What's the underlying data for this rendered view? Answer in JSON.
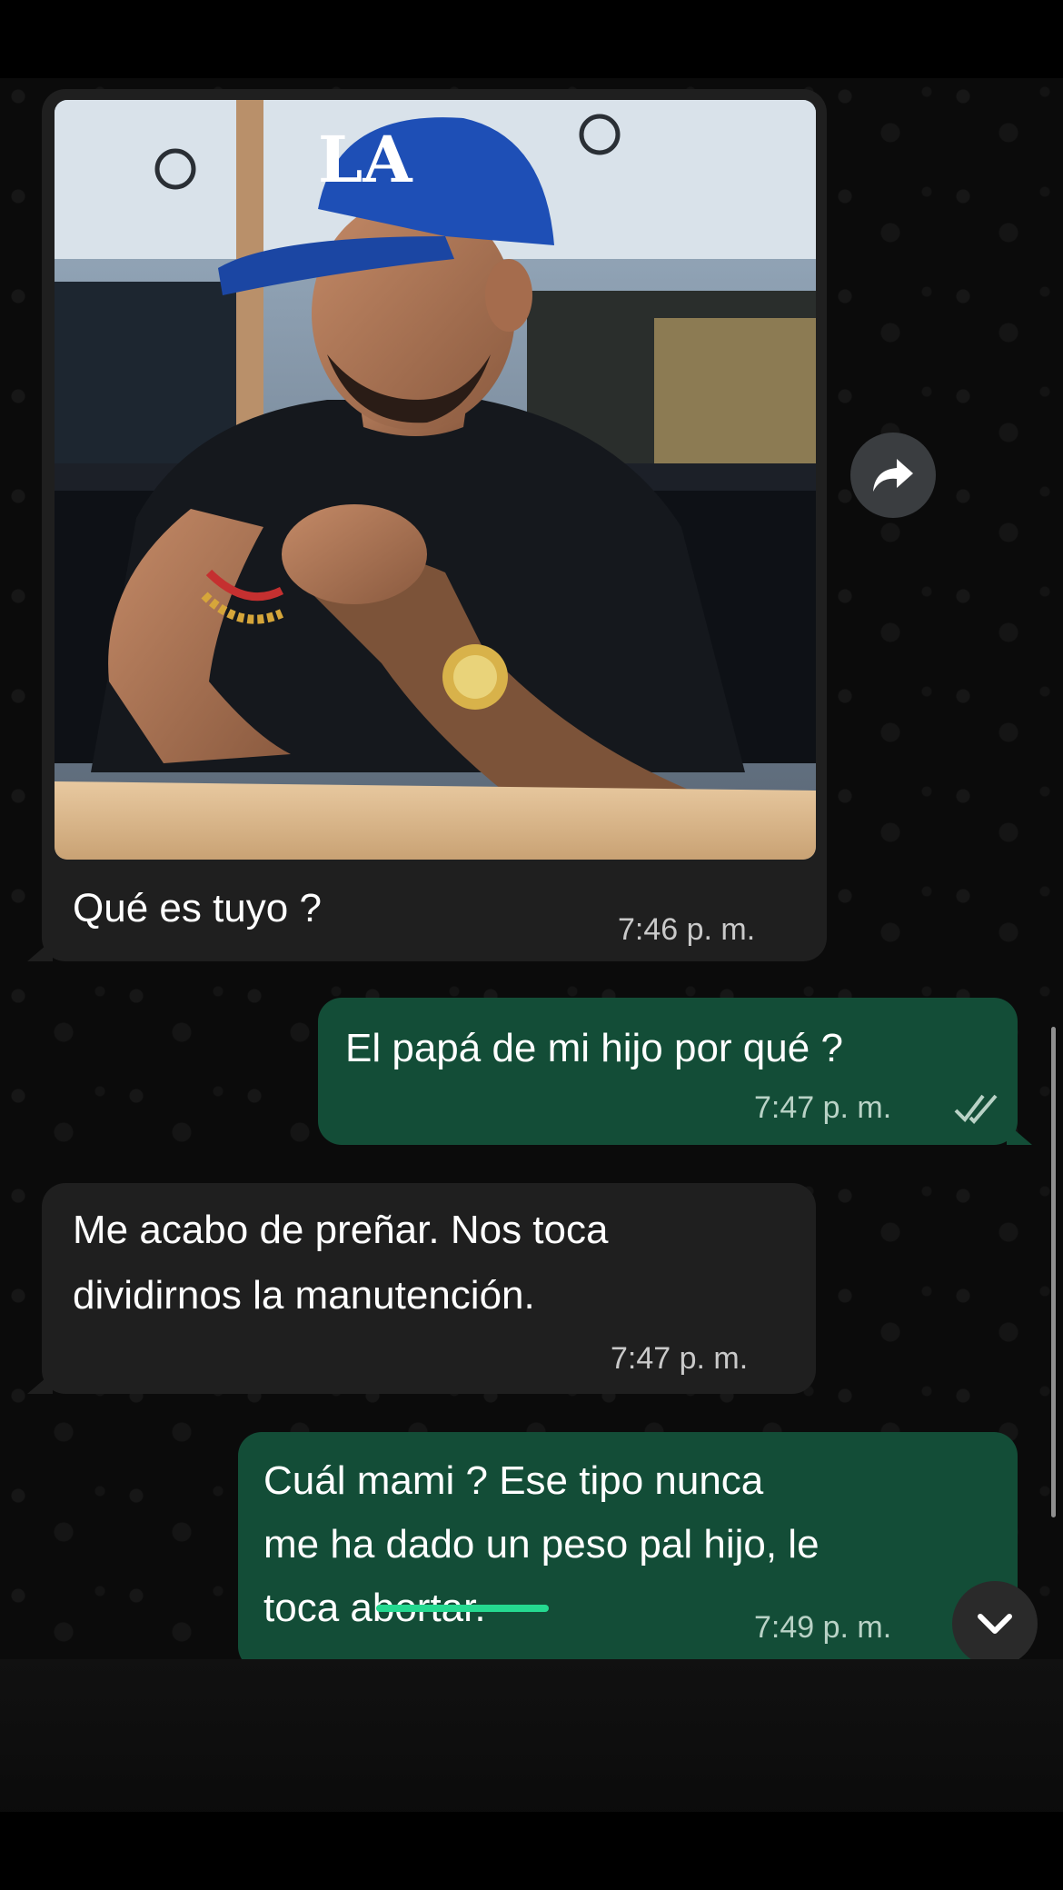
{
  "theme": {
    "chat_background": "#0b0b0b",
    "incoming_bubble": "#1f1f1f",
    "outgoing_bubble": "#134d37",
    "read_ticks": "#b9d2c6",
    "highlight_strike": "#25d990"
  },
  "image_message": {
    "photo_alt": "photo",
    "caption": "Qué es tuyo ?",
    "time": "7:46 p. m."
  },
  "messages": [
    {
      "id": "m2",
      "direction": "out",
      "lines": [
        "El papá de mi hijo por qué ?"
      ],
      "time": "7:47 p. m.",
      "status_icon": "double-check-icon"
    },
    {
      "id": "m3",
      "direction": "in",
      "lines": [
        "Me acabo de preñar. Nos toca",
        "dividirnos la manutención."
      ],
      "time": "7:47 p. m."
    },
    {
      "id": "m4",
      "direction": "out",
      "lines": [
        "Cuál mami ? Ese tipo nunca",
        "me ha dado un peso pal hijo, le",
        "toca abortar."
      ],
      "time": "7:49 p. m."
    }
  ],
  "controls": {
    "forward_icon": "forward-arrow-icon",
    "scroll_down_icon": "chevron-down-icon"
  }
}
